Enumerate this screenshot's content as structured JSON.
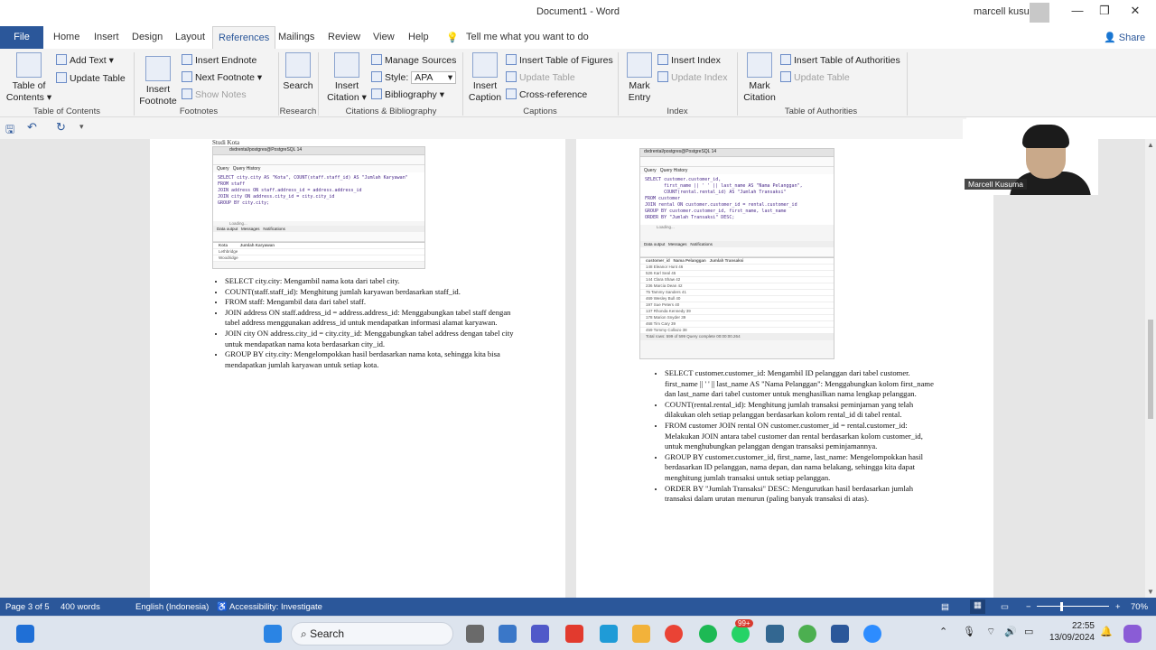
{
  "window": {
    "title": "Document1 - Word",
    "user": "marcell kusuma"
  },
  "tabs": [
    "File",
    "Home",
    "Insert",
    "Design",
    "Layout",
    "References",
    "Mailings",
    "Review",
    "View",
    "Help"
  ],
  "tell_me": "Tell me what you want to do",
  "share": "Share",
  "ribbon": {
    "toc": {
      "big": "Table of Contents",
      "add_text": "Add Text",
      "update_table": "Update Table",
      "label": "Table of Contents"
    },
    "footnotes": {
      "big": "Insert Footnote",
      "insert_endnote": "Insert Endnote",
      "next_footnote": "Next Footnote",
      "show_notes": "Show Notes",
      "label": "Footnotes"
    },
    "research": {
      "big": "Search",
      "label": "Research"
    },
    "citations": {
      "big": "Insert Citation",
      "manage_sources": "Manage Sources",
      "style_label": "Style:",
      "style_value": "APA",
      "bibliography": "Bibliography",
      "label": "Citations & Bibliography"
    },
    "captions": {
      "big": "Insert Caption",
      "insert_tof": "Insert Table of Figures",
      "update_table": "Update Table",
      "cross_reference": "Cross-reference",
      "label": "Captions"
    },
    "index": {
      "big": "Mark Entry",
      "insert_index": "Insert Index",
      "update_index": "Update Index",
      "label": "Index"
    },
    "toa": {
      "big": "Mark Citation",
      "insert_toa": "Insert Table of Authorities",
      "update_table": "Update Table",
      "label": "Table of Authorities"
    }
  },
  "page_left": {
    "heading": "Studi Kota",
    "screenshot": {
      "path": "dvdrental/postgres@PostgreSQL 14",
      "tabs": [
        "Query",
        "Query History"
      ],
      "code": "SELECT city.city AS \"Kota\", COUNT(staff.staff_id) AS \"Jumlah Karyawan\"\nFROM staff\nJOIN address ON staff.address_id = address.address_id\nJOIN city ON address.city_id = city.city_id\nGROUP BY city.city;",
      "loading": "Loading...",
      "output_tabs": [
        "Data output",
        "Messages",
        "Notifications"
      ],
      "columns": [
        "Kota",
        "Jumlah Karyawan"
      ],
      "rows": [
        "Lethbridge",
        "Woodridge"
      ]
    },
    "bullets": [
      "SELECT city.city: Mengambil nama kota dari tabel city.",
      "COUNT(staff.staff_id): Menghitung jumlah karyawan berdasarkan staff_id.",
      "FROM staff: Mengambil data dari tabel staff.",
      "JOIN address ON staff.address_id = address.address_id: Menggabungkan tabel staff dengan tabel address menggunakan address_id untuk mendapatkan informasi alamat karyawan.",
      "JOIN city ON address.city_id = city.city_id: Menggabungkan tabel address dengan tabel city untuk mendapatkan nama kota berdasarkan city_id.",
      "GROUP BY city.city: Mengelompokkan hasil berdasarkan nama kota, sehingga kita bisa mendapatkan jumlah karyawan untuk setiap kota."
    ]
  },
  "page_right": {
    "screenshot": {
      "path": "dvdrental/postgres@PostgreSQL 14",
      "tabs": [
        "Query",
        "Query History"
      ],
      "code": "SELECT customer.customer_id,\n       first_name || ' ' || last_name AS \"Nama Pelanggan\",\n       COUNT(rental.rental_id) AS \"Jumlah Transaksi\"\nFROM customer\nJOIN rental ON customer.customer_id = rental.customer_id\nGROUP BY customer.customer_id, first_name, last_name\nORDER BY \"Jumlah Transaksi\" DESC;",
      "loading": "Loading...",
      "output_tabs": [
        "Data output",
        "Messages",
        "Notifications"
      ],
      "columns": [
        "customer_id",
        "Nama Pelanggan",
        "Jumlah Transaksi"
      ],
      "rows": [
        "148  Eleanor Hunt  46",
        "526  Karl Seal  45",
        "144  Clara Shaw  42",
        "236  Marcia Dean  42",
        "75  Tammy Sanders  41",
        "469  Wesley Bull  40",
        "197  Sue Peters  40",
        "137  Rhonda Kennedy  39",
        "178  Marion Snyder  39",
        "468  Tim Cary  39",
        "459  Tommy Collazo  38"
      ],
      "footer": "Total rows: 599 of 599     Query complete 00:00:00.264"
    },
    "bullets": [
      "SELECT customer.customer_id: Mengambil ID pelanggan dari tabel customer.",
      "first_name || ' ' || last_name AS \"Nama Pelanggan\": Menggabungkan kolom first_name dan last_name dari tabel customer untuk menghasilkan nama lengkap pelanggan.",
      "COUNT(rental.rental_id): Menghitung jumlah transaksi peminjaman yang telah dilakukan oleh setiap pelanggan berdasarkan kolom rental_id di tabel rental.",
      "FROM customer JOIN rental ON customer.customer_id = rental.customer_id: Melakukan JOIN antara tabel customer dan rental berdasarkan kolom customer_id, untuk menghubungkan pelanggan dengan transaksi peminjamannya.",
      "GROUP BY customer.customer_id, first_name, last_name: Mengelompokkan hasil berdasarkan ID pelanggan, nama depan, dan nama belakang, sehingga kita dapat menghitung jumlah transaksi untuk setiap pelanggan.",
      "ORDER BY \"Jumlah Transaksi\" DESC: Mengurutkan hasil berdasarkan jumlah transaksi dalam urutan menurun (paling banyak transaksi di atas)."
    ]
  },
  "webcam": {
    "name": "Marcell Kusuma"
  },
  "status": {
    "page": "Page 3 of 5",
    "words": "400 words",
    "language": "English (Indonesia)",
    "accessibility": "Accessibility: Investigate",
    "zoom": "70%"
  },
  "taskbar": {
    "search": "Search",
    "time": "22:55",
    "date": "13/09/2024",
    "badge": "99+"
  },
  "colors": {
    "word_blue": "#2b579a"
  }
}
